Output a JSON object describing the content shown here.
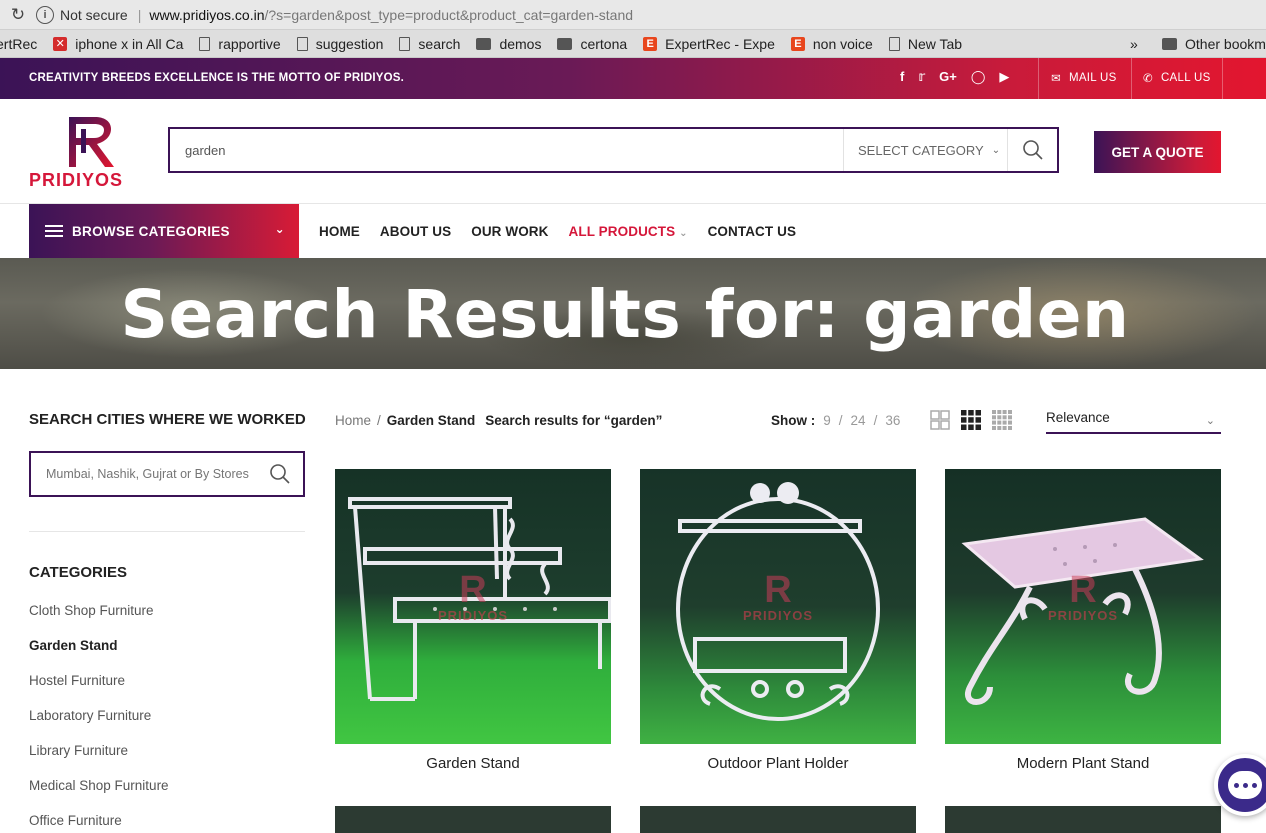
{
  "browser": {
    "security": "Not secure",
    "url_host": "www.pridiyos.co.in",
    "url_path": "/?s=garden&post_type=product&product_cat=garden-stand"
  },
  "bookmarks": {
    "items": [
      {
        "label": "ertRec",
        "icon": "none"
      },
      {
        "label": "iphone x in All Ca",
        "icon": "redx"
      },
      {
        "label": "rapportive",
        "icon": "file"
      },
      {
        "label": "suggestion",
        "icon": "file"
      },
      {
        "label": "search",
        "icon": "file"
      },
      {
        "label": "demos",
        "icon": "folder"
      },
      {
        "label": "certona",
        "icon": "folder"
      },
      {
        "label": "ExpertRec - Expe",
        "icon": "red"
      },
      {
        "label": "non voice",
        "icon": "red"
      },
      {
        "label": "New Tab",
        "icon": "file"
      }
    ],
    "more": "»",
    "other": "Other bookm"
  },
  "topbar": {
    "motto": "CREATIVITY BREEDS EXCELLENCE IS THE MOTTO OF PRIDIYOS.",
    "socials": [
      "f",
      "t",
      "G+",
      "ig",
      "yt"
    ],
    "mail_label": "MAIL US",
    "call_label": "CALL US"
  },
  "header": {
    "logo_text": "PRIDIYOS",
    "search_value": "garden",
    "category_label": "SELECT CATEGORY",
    "quote_label": "GET A QUOTE"
  },
  "nav": {
    "browse_label": "BROWSE CATEGORIES",
    "items": [
      "HOME",
      "ABOUT US",
      "OUR WORK",
      "ALL PRODUCTS",
      "CONTACT US"
    ]
  },
  "hero": {
    "title": "Search Results for: garden"
  },
  "sidebar": {
    "cities_title": "SEARCH CITIES WHERE WE WORKED",
    "cities_placeholder": "Mumbai, Nashik, Gujrat or By Stores",
    "categories_title": "CATEGORIES",
    "categories": [
      "Cloth Shop Furniture",
      "Garden Stand",
      "Hostel Furniture",
      "Laboratory Furniture",
      "Library Furniture",
      "Medical Shop Furniture",
      "Office Furniture"
    ]
  },
  "toolbar": {
    "crumb_home": "Home",
    "crumb_sep": "/",
    "crumb_cat": "Garden Stand",
    "crumb_result": "Search results for “garden”",
    "show_label": "Show :",
    "show_options": [
      "9",
      "/",
      "24",
      "/",
      "36"
    ],
    "sort_value": "Relevance"
  },
  "products": [
    {
      "name": "Garden Stand"
    },
    {
      "name": "Outdoor Plant Holder"
    },
    {
      "name": "Modern Plant Stand"
    }
  ],
  "watermark": {
    "mark": "R",
    "word": "PRIDIYOS"
  }
}
